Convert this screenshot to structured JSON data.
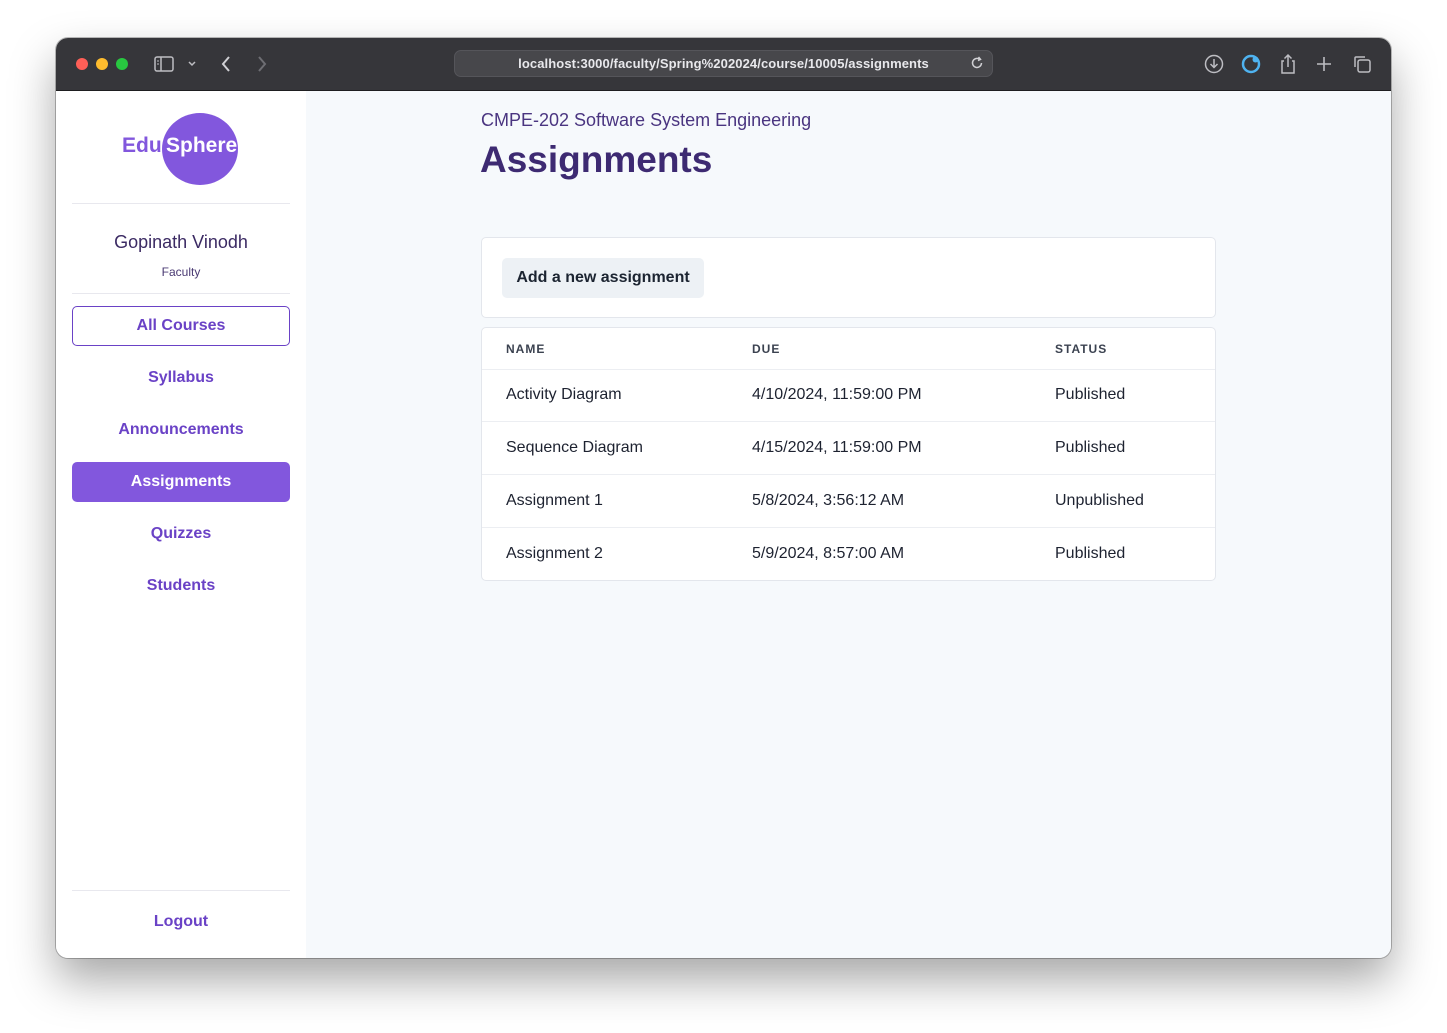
{
  "browser": {
    "url": "localhost:3000/faculty/Spring%202024/course/10005/assignments"
  },
  "brand": {
    "logo_left": "Edu",
    "logo_right": "Sphere",
    "primary_color": "#8257dd"
  },
  "user": {
    "name": "Gopinath Vinodh",
    "role": "Faculty"
  },
  "nav": {
    "all_courses": "All Courses",
    "syllabus": "Syllabus",
    "announcements": "Announcements",
    "assignments": "Assignments",
    "quizzes": "Quizzes",
    "students": "Students",
    "logout": "Logout",
    "active": "assignments"
  },
  "page": {
    "course_title": "CMPE-202 Software System Engineering",
    "title": "Assignments",
    "add_button": "Add a new assignment"
  },
  "table": {
    "headers": [
      "NAME",
      "DUE",
      "STATUS"
    ],
    "rows": [
      {
        "name": "Activity Diagram",
        "due": "4/10/2024, 11:59:00 PM",
        "status": "Published"
      },
      {
        "name": "Sequence Diagram",
        "due": "4/15/2024, 11:59:00 PM",
        "status": "Published"
      },
      {
        "name": "Assignment 1",
        "due": "5/8/2024, 3:56:12 AM",
        "status": "Unpublished"
      },
      {
        "name": "Assignment 2",
        "due": "5/9/2024, 8:57:00 AM",
        "status": "Published"
      }
    ]
  }
}
